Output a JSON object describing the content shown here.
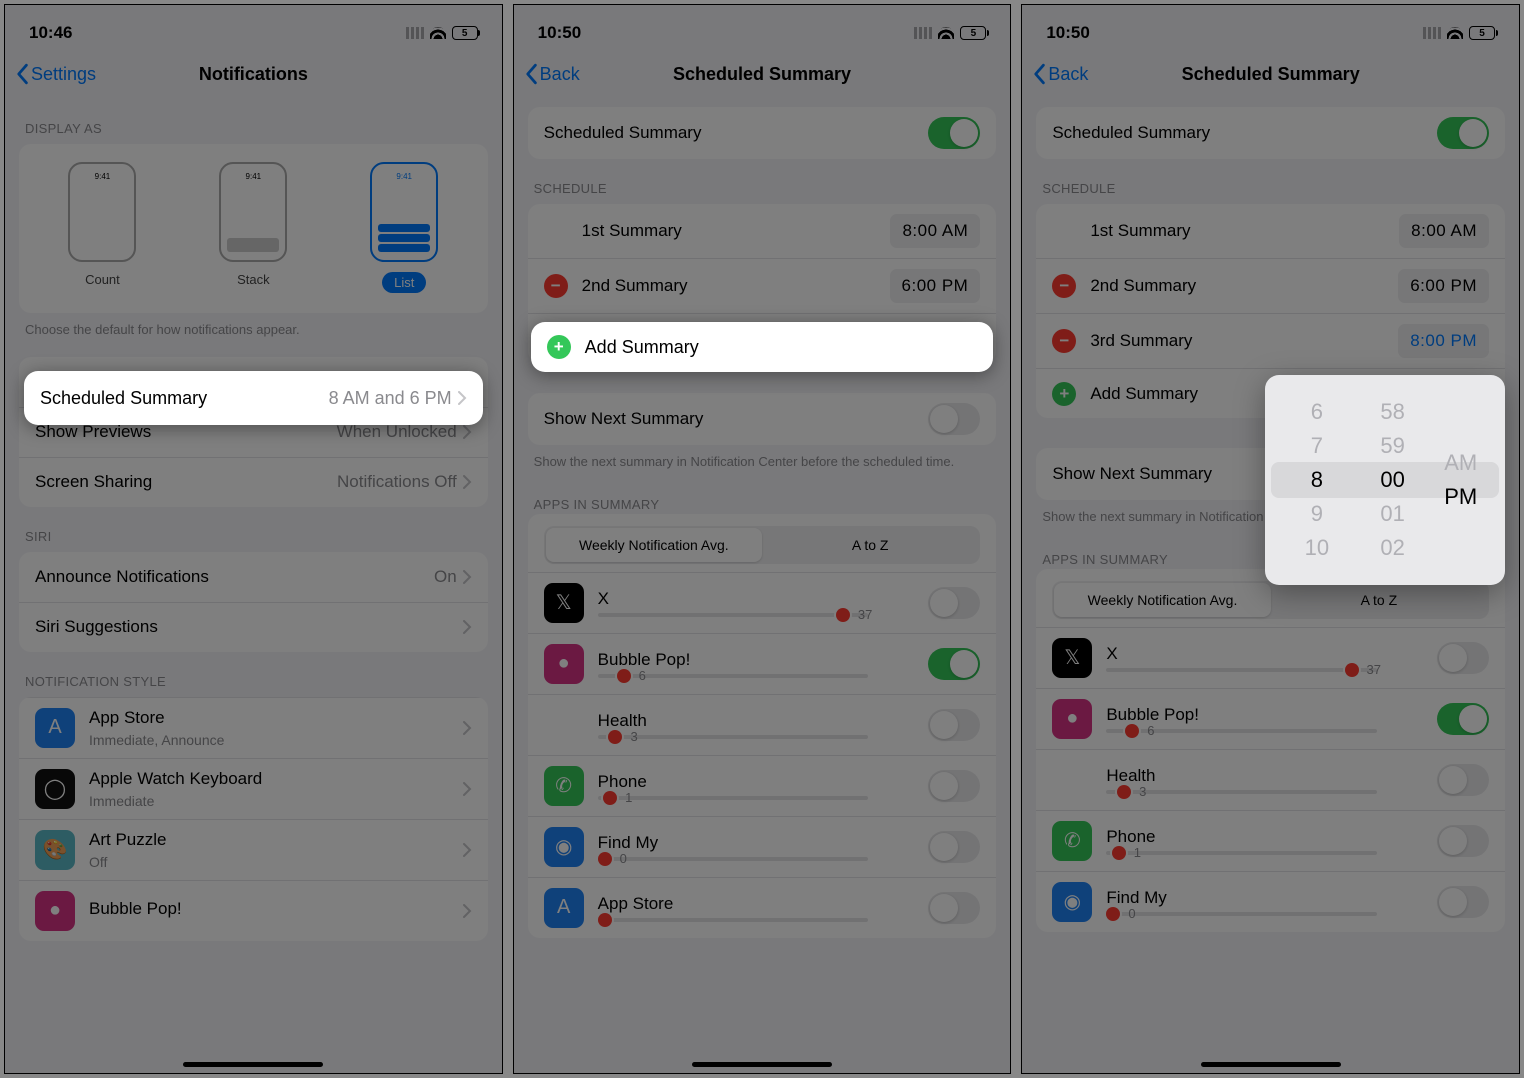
{
  "shared": {
    "mock_time": "9:41",
    "batt_label": "5"
  },
  "s1": {
    "time": "10:46",
    "nav_back": "Settings",
    "nav_title": "Notifications",
    "sections": {
      "display_as": {
        "header": "DISPLAY AS",
        "options": [
          "Count",
          "Stack",
          "List"
        ],
        "footer": "Choose the default for how notifications appear."
      },
      "scheduled_summary": {
        "label": "Scheduled Summary",
        "value": "8 AM and 6 PM"
      },
      "show_previews": {
        "label": "Show Previews",
        "value": "When Unlocked"
      },
      "screen_sharing": {
        "label": "Screen Sharing",
        "value": "Notifications Off"
      },
      "siri_header": "SIRI",
      "announce": {
        "label": "Announce Notifications",
        "value": "On"
      },
      "siri_sugg": {
        "label": "Siri Suggestions"
      },
      "style_header": "NOTIFICATION STYLE",
      "apps": [
        {
          "name": "App Store",
          "sub": "Immediate, Announce",
          "color": "#1e82f5",
          "glyph": "A"
        },
        {
          "name": "Apple Watch Keyboard",
          "sub": "Immediate",
          "color": "#111",
          "glyph": "◯"
        },
        {
          "name": "Art Puzzle",
          "sub": "Off",
          "color": "#5bb8c7",
          "glyph": "🎨"
        },
        {
          "name": "Bubble Pop!",
          "sub": "",
          "color": "#d63384",
          "glyph": "●"
        }
      ]
    }
  },
  "s2": {
    "time": "10:50",
    "nav_back": "Back",
    "nav_title": "Scheduled Summary",
    "master": {
      "label": "Scheduled Summary"
    },
    "schedule_header": "SCHEDULE",
    "summaries": [
      {
        "label": "1st Summary",
        "time": "8:00 AM",
        "del": false
      },
      {
        "label": "2nd Summary",
        "time": "6:00 PM",
        "del": true
      }
    ],
    "add_summary": "Add Summary",
    "show_next": {
      "label": "Show Next Summary",
      "footer": "Show the next summary in Notification Center before the scheduled time."
    },
    "apps_header": "APPS IN SUMMARY",
    "seg": {
      "a": "Weekly Notification Avg.",
      "b": "A to Z"
    },
    "apps": [
      {
        "name": "X",
        "avg": "37",
        "on": false,
        "color": "#000",
        "glyph": "𝕏",
        "pos": 88
      },
      {
        "name": "Bubble Pop!",
        "avg": "6",
        "on": true,
        "color": "#d63384",
        "glyph": "●",
        "pos": 7
      },
      {
        "name": "Health",
        "avg": "3",
        "on": false,
        "color": "#fff",
        "glyph": "❤︎",
        "pos": 4
      },
      {
        "name": "Phone",
        "avg": "1",
        "on": false,
        "color": "#34c759",
        "glyph": "✆",
        "pos": 2
      },
      {
        "name": "Find My",
        "avg": "0",
        "on": false,
        "color": "#1e82f5",
        "glyph": "◉",
        "pos": 0
      },
      {
        "name": "App Store",
        "avg": "",
        "on": false,
        "color": "#1e82f5",
        "glyph": "A",
        "pos": 0
      }
    ]
  },
  "s3": {
    "time": "10:50",
    "nav_back": "Back",
    "nav_title": "Scheduled Summary",
    "master": {
      "label": "Scheduled Summary"
    },
    "schedule_header": "SCHEDULE",
    "summaries": [
      {
        "label": "1st Summary",
        "time": "8:00 AM",
        "del": false
      },
      {
        "label": "2nd Summary",
        "time": "6:00 PM",
        "del": true
      },
      {
        "label": "3rd Summary",
        "time": "8:00 PM",
        "del": true,
        "active": true
      }
    ],
    "add_summary": "Add Summary",
    "show_next": {
      "label": "Show Next Summary",
      "footer": "Show the next summary in Notification Center before the scheduled time."
    },
    "apps_header": "APPS IN SUMMARY",
    "seg": {
      "a": "Weekly Notification Avg.",
      "b": "A to Z"
    },
    "apps": [
      {
        "name": "X",
        "avg": "37",
        "on": false,
        "color": "#000",
        "glyph": "𝕏",
        "pos": 88
      },
      {
        "name": "Bubble Pop!",
        "avg": "6",
        "on": true,
        "color": "#d63384",
        "glyph": "●",
        "pos": 7
      },
      {
        "name": "Health",
        "avg": "3",
        "on": false,
        "color": "#fff",
        "glyph": "❤︎",
        "pos": 4
      },
      {
        "name": "Phone",
        "avg": "1",
        "on": false,
        "color": "#34c759",
        "glyph": "✆",
        "pos": 2
      },
      {
        "name": "Find My",
        "avg": "0",
        "on": false,
        "color": "#1e82f5",
        "glyph": "◉",
        "pos": 0
      }
    ],
    "picker": {
      "hour_items": [
        "6",
        "7",
        "8",
        "9",
        "10"
      ],
      "min_items": [
        "58",
        "59",
        "00",
        "01",
        "02"
      ],
      "ampm_items": [
        "AM",
        "PM"
      ],
      "sel_hour": "8",
      "sel_min": "00",
      "sel_ampm": "PM"
    }
  }
}
